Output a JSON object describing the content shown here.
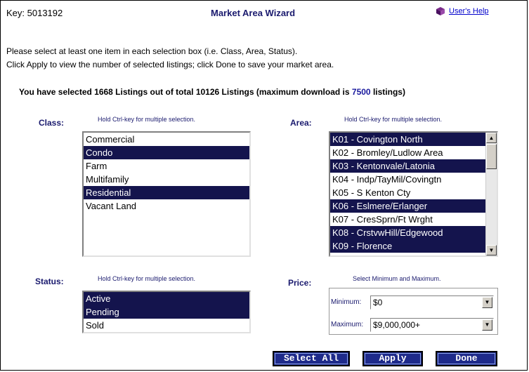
{
  "header": {
    "key_text": "Key: 5013192",
    "title": "Market Area Wizard",
    "help_label": "User's Help"
  },
  "instructions": {
    "line1": "Please select at least one item in each selection box (i.e. Class, Area, Status).",
    "line2": "Click Apply to view the number of selected listings; click Done to save your market area."
  },
  "summary": {
    "prefix": "You have selected 1668 Listings out of total 10126 Listings (maximum download is ",
    "max_download": "7500",
    "suffix": " listings)"
  },
  "class_box": {
    "label": "Class:",
    "hint": "Hold Ctrl-key for multiple selection.",
    "options": [
      {
        "text": "Commercial",
        "selected": false
      },
      {
        "text": "Condo",
        "selected": true
      },
      {
        "text": "Farm",
        "selected": false
      },
      {
        "text": "Multifamily",
        "selected": false
      },
      {
        "text": "Residential",
        "selected": true
      },
      {
        "text": "Vacant Land",
        "selected": false
      }
    ]
  },
  "area_box": {
    "label": "Area:",
    "hint": "Hold Ctrl-key for multiple selection.",
    "options": [
      {
        "text": "K01 - Covington North",
        "selected": true
      },
      {
        "text": "K02 - Bromley/Ludlow Area",
        "selected": false
      },
      {
        "text": "K03 - Kentonvale/Latonia",
        "selected": true
      },
      {
        "text": "K04 - Indp/TayMil/Covingtn",
        "selected": false
      },
      {
        "text": "K05 - S Kenton Cty",
        "selected": false
      },
      {
        "text": "K06 - Eslmere/Erlanger",
        "selected": true
      },
      {
        "text": "K07 - CresSprn/Ft Wrght",
        "selected": false
      },
      {
        "text": "K08 - CrstvwHill/Edgewood",
        "selected": true
      },
      {
        "text": "K09 - Florence",
        "selected": true
      }
    ]
  },
  "status_box": {
    "label": "Status:",
    "hint": "Hold Ctrl-key for multiple selection.",
    "options": [
      {
        "text": "Active",
        "selected": true
      },
      {
        "text": "Pending",
        "selected": true
      },
      {
        "text": "Sold",
        "selected": false
      }
    ]
  },
  "price": {
    "label": "Price:",
    "hint": "Select Minimum and Maximum.",
    "min_label": "Minimum:",
    "min_value": "$0",
    "max_label": "Maximum:",
    "max_value": "$9,000,000+"
  },
  "buttons": {
    "select_all": "Select All",
    "apply": "Apply",
    "done": "Done"
  },
  "colors": {
    "selection": "#14144d",
    "button": "#1e2a8a",
    "label": "#1a1a6e"
  }
}
